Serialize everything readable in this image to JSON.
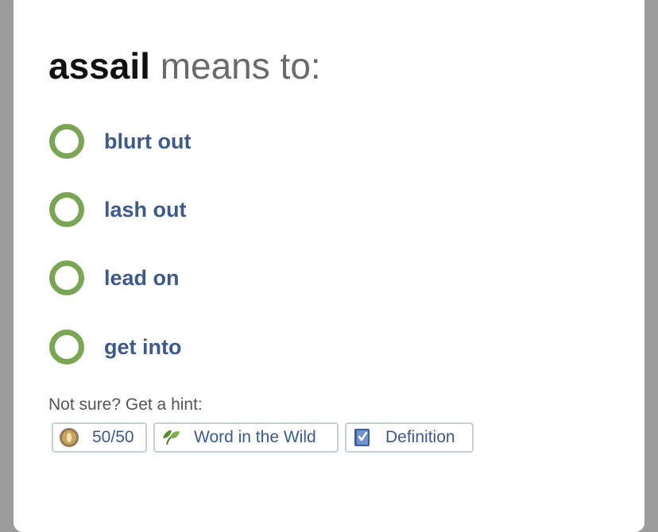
{
  "question": {
    "word": "assail",
    "prompt": "means to:"
  },
  "choices": [
    {
      "label": "blurt out"
    },
    {
      "label": "lash out"
    },
    {
      "label": "lead on"
    },
    {
      "label": "get into"
    }
  ],
  "hints": {
    "label": "Not sure? Get a hint:",
    "buttons": [
      {
        "label": "50/50",
        "icon": "coin-icon"
      },
      {
        "label": "Word in the Wild",
        "icon": "leaf-icon"
      },
      {
        "label": "Definition",
        "icon": "book-icon"
      }
    ]
  },
  "colors": {
    "radio_ring": "#7aa554",
    "choice_text": "#3d5a8c",
    "backdrop": "#9b9b9b"
  }
}
